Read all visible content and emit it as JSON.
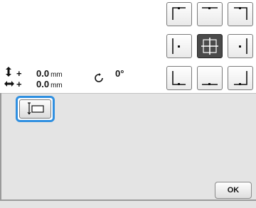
{
  "readout": {
    "vertical": {
      "icon": "vertical-move-icon",
      "sign": "+",
      "value": "0.0",
      "unit": "mm"
    },
    "horizontal": {
      "icon": "horizontal-move-icon",
      "sign": "+",
      "value": "0.0",
      "unit": "mm"
    },
    "rotation": {
      "icon": "rotate-icon",
      "value": "0°"
    }
  },
  "position_grid": {
    "buttons": [
      {
        "name": "top-left",
        "icon": "top-left-align-icon",
        "active": false
      },
      {
        "name": "top-center",
        "icon": "top-center-align-icon",
        "active": false
      },
      {
        "name": "top-right",
        "icon": "top-right-align-icon",
        "active": false
      },
      {
        "name": "middle-left",
        "icon": "middle-left-align-icon",
        "active": false
      },
      {
        "name": "center",
        "icon": "center-align-icon",
        "active": true
      },
      {
        "name": "middle-right",
        "icon": "middle-right-align-icon",
        "active": false
      },
      {
        "name": "bottom-left",
        "icon": "bottom-left-align-icon",
        "active": false
      },
      {
        "name": "bottom-center",
        "icon": "bottom-center-align-icon",
        "active": false
      },
      {
        "name": "bottom-right",
        "icon": "bottom-right-align-icon",
        "active": false
      }
    ]
  },
  "panel": {
    "baste_button": {
      "icon": "basting-icon",
      "highlighted": true
    },
    "ok_label": "OK"
  },
  "colors": {
    "highlight": "#2f8fe0",
    "panel_bg": "#e4e4e4",
    "active_button": "#4a4a4a"
  }
}
